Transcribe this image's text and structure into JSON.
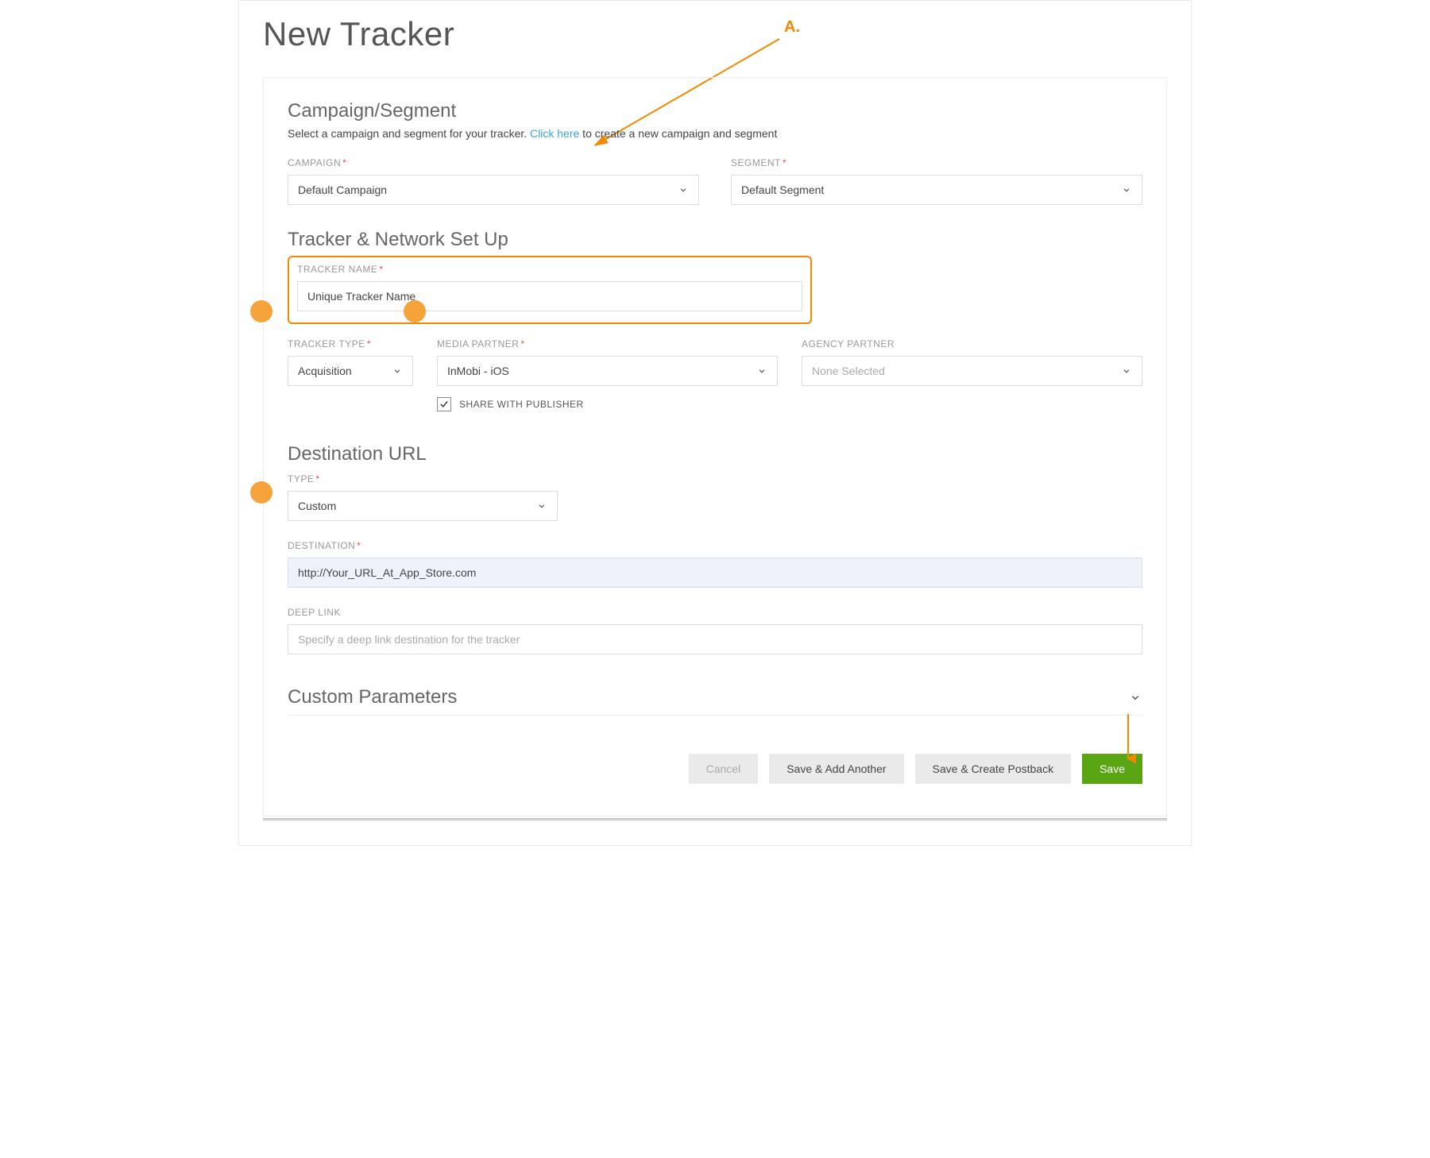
{
  "page": {
    "title": "New Tracker"
  },
  "annotation": {
    "label": "A."
  },
  "section_campaign": {
    "title": "Campaign/Segment",
    "subtext_before": "Select a campaign and segment for your tracker. ",
    "link": "Click here",
    "subtext_after": " to create a new campaign and segment",
    "campaign_label": "CAMPAIGN",
    "campaign_value": "Default Campaign",
    "segment_label": "SEGMENT",
    "segment_value": "Default Segment"
  },
  "section_tracker": {
    "title": "Tracker & Network Set Up",
    "name_label": "TRACKER NAME",
    "name_value": "Unique Tracker Name",
    "type_label": "TRACKER TYPE",
    "type_value": "Acquisition",
    "media_label": "MEDIA PARTNER",
    "media_value": "InMobi - iOS",
    "agency_label": "AGENCY PARTNER",
    "agency_value": "None Selected",
    "share_label": "SHARE WITH PUBLISHER"
  },
  "section_dest": {
    "title": "Destination URL",
    "type_label": "TYPE",
    "type_value": "Custom",
    "dest_label": "DESTINATION",
    "dest_value": "http://Your_URL_At_App_Store.com",
    "deep_label": "DEEP LINK",
    "deep_placeholder": "Specify a deep link destination for the tracker"
  },
  "section_custom": {
    "title": "Custom Parameters"
  },
  "buttons": {
    "cancel": "Cancel",
    "save_add": "Save & Add Another",
    "save_postback": "Save & Create Postback",
    "save": "Save"
  }
}
